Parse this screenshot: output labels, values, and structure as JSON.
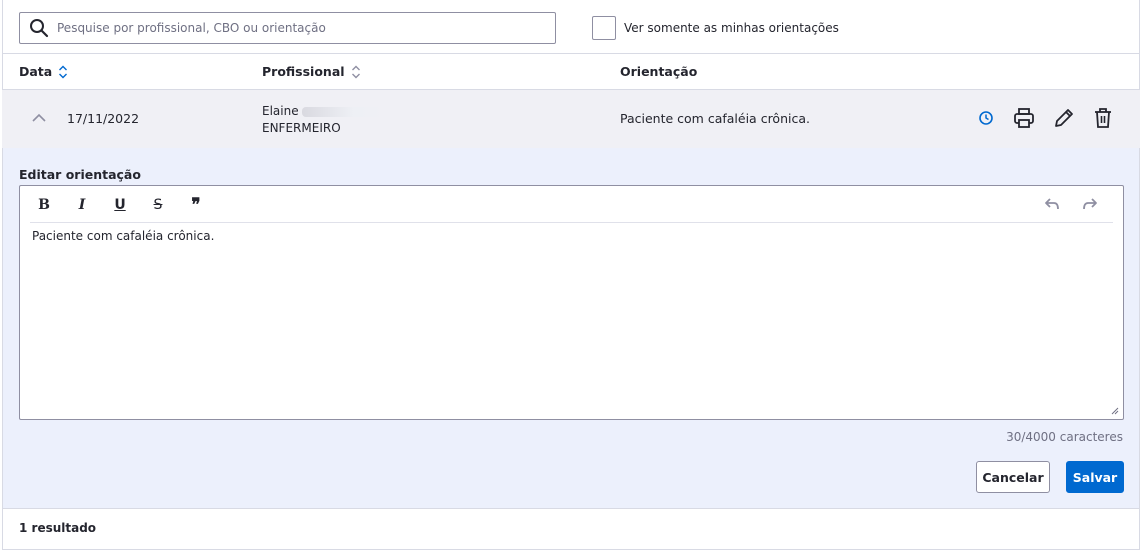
{
  "search": {
    "placeholder": "Pesquise por profissional, CBO ou orientação"
  },
  "filter": {
    "label": "Ver somente as minhas orientações",
    "checked": false
  },
  "table": {
    "columns": [
      {
        "label": "Data",
        "sort_icon": "sort-active-icon"
      },
      {
        "label": "Profissional",
        "sort_icon": "sort-icon"
      },
      {
        "label": "Orientação"
      }
    ],
    "rows": [
      {
        "date": "17/11/2022",
        "professional_name": "Elaine",
        "professional_role": "ENFERMEIRO",
        "orientation": "Paciente com cafaléia crônica.",
        "actions": [
          "history-icon",
          "print-icon",
          "edit-icon",
          "delete-icon"
        ]
      }
    ]
  },
  "editor": {
    "label": "Editar orientação",
    "toolbar": {
      "bold": "B",
      "italic": "I",
      "underline": "U",
      "strike": "S",
      "quote": "❞"
    },
    "content": "Paciente com cafaléia crônica.",
    "counter": "30/4000 caracteres",
    "cancel_label": "Cancelar",
    "save_label": "Salvar"
  },
  "footer": {
    "result_count": "1 resultado"
  },
  "colors": {
    "primary": "#0069d0",
    "row_bg": "#f0f0f5",
    "edit_bg": "#ecf0fc",
    "border": "#8f8fa2"
  }
}
